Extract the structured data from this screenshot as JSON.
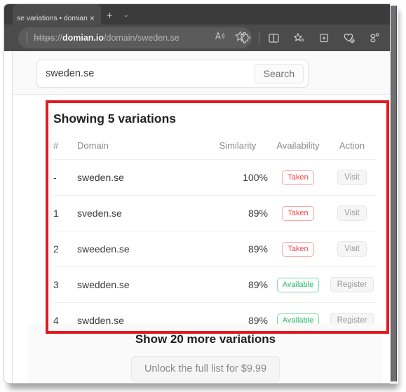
{
  "browser": {
    "tab": {
      "title": "se variations • domian.i",
      "close_icon": "×"
    },
    "new_tab_icon": "+",
    "tab_list_icon": "⌄",
    "address": {
      "scheme": "https",
      "separator": "://",
      "host": "domian.io",
      "path": "/domain/sweden.se",
      "read_aloud_icon": "read-aloud",
      "favorite_icon": "star"
    },
    "toolbar_icons": [
      "extensions-icon",
      "split-screen-icon",
      "favorites-icon",
      "collections-icon",
      "browser-essentials-icon",
      "settings-icon"
    ]
  },
  "search": {
    "value": "sweden.se",
    "placeholder": "sweden.se",
    "button_label": "Search"
  },
  "results": {
    "heading": "Showing 5 variations",
    "columns": {
      "num": "#",
      "domain": "Domain",
      "similarity": "Similarity",
      "availability": "Availability",
      "action": "Action"
    },
    "rows": [
      {
        "num": "-",
        "domain": "sweden.se",
        "similarity": "100%",
        "availability": "Taken",
        "action": "Visit"
      },
      {
        "num": "1",
        "domain": "sveden.se",
        "similarity": "89%",
        "availability": "Taken",
        "action": "Visit"
      },
      {
        "num": "2",
        "domain": "sweeden.se",
        "similarity": "89%",
        "availability": "Taken",
        "action": "Visit"
      },
      {
        "num": "3",
        "domain": "swedden.se",
        "similarity": "89%",
        "availability": "Available",
        "action": "Register"
      },
      {
        "num": "4",
        "domain": "swdden.se",
        "similarity": "89%",
        "availability": "Available",
        "action": "Register"
      }
    ]
  },
  "upsell": {
    "heading": "Show 20 more variations",
    "button_label": "Unlock the full list for $9.99"
  },
  "annotation": {
    "color": "#e01b22"
  },
  "colors": {
    "taken": "#ef4b4b",
    "available": "#24b864",
    "annotation": "#e01b22",
    "tab_strip": "#3b3b3b",
    "toolbar": "#4b4b4b"
  }
}
